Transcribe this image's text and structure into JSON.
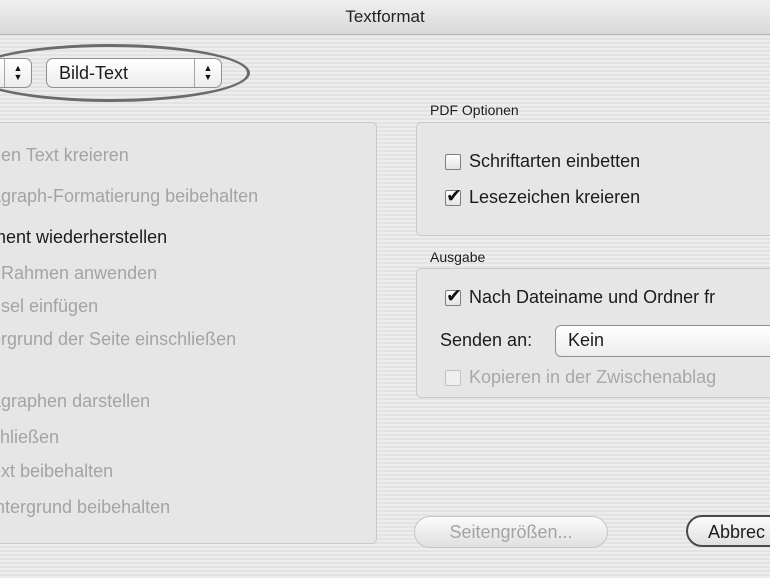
{
  "window": {
    "title": "Textformat"
  },
  "top_popups": {
    "left_arrows": "▲▼",
    "mode": {
      "value": "Bild-Text"
    }
  },
  "left_panel": {
    "items": [
      {
        "text": "nen Text kreieren",
        "enabled": false
      },
      {
        "text": "agraph-Formatierung beibehalten",
        "enabled": false
      },
      {
        "text": "ment wiederherstellen",
        "enabled": true
      },
      {
        "text": "t Rahmen anwenden",
        "enabled": false
      },
      {
        "text": "hsel einfügen",
        "enabled": false
      },
      {
        "text": "ergrund der Seite einschließen",
        "enabled": false
      },
      {
        "text": "agraphen darstellen",
        "enabled": false
      },
      {
        "text": "chließen",
        "enabled": false
      },
      {
        "text": "ext beibehalten",
        "enabled": false
      },
      {
        "text": "intergrund beibehalten",
        "enabled": false
      }
    ]
  },
  "pdf_options": {
    "label": "PDF Optionen",
    "embed_fonts": {
      "label": "Schriftarten einbetten",
      "checked": false
    },
    "create_bookmarks": {
      "label": "Lesezeichen kreieren",
      "checked": true
    }
  },
  "output": {
    "label": "Ausgabe",
    "by_filename": {
      "label": "Nach Dateiname und Ordner fr",
      "checked": true
    },
    "send_to": {
      "label": "Senden an:",
      "value": "Kein"
    },
    "copy_clipboard": {
      "label": "Kopieren in der Zwischenablag",
      "checked": false,
      "enabled": false
    }
  },
  "buttons": {
    "page_sizes": {
      "label": "Seitengrößen...",
      "enabled": false
    },
    "cancel": {
      "label": "Abbrec"
    }
  }
}
